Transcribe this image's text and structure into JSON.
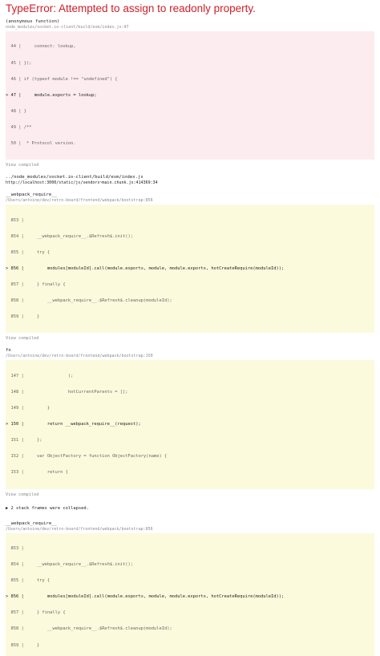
{
  "error_title": "TypeError: Attempted to assign to readonly property.",
  "frames": [
    {
      "name": "(anonymous function)",
      "path": "node_modules/socket.io-client/build/esm/index.js:47",
      "tint": "red",
      "lines": [
        "  44 |     connect: lookup,",
        "  45 | });",
        "  46 | if (typeof module !== \"undefined\") {",
        "> 47 |     module.exports = lookup;",
        "  48 | }",
        "  49 | /**",
        "  50 |  * Protocol version."
      ],
      "view_compiled": "View compiled"
    },
    {
      "name": "../node_modules/socket.io-client/build/esm/index.js",
      "path": "http://localhost:3000/static/js/vendors~main.chunk.js:414369:34",
      "path_dark": true
    },
    {
      "name": "__webpack_require__",
      "path": "/Users/antoine/dev/retro-board/frontend/webpack/bootstrap:856",
      "tint": "yellow",
      "lines": [
        "  853 |",
        "  854 |     __webpack_require__.$Refresh$.init();",
        "  855 |     try {",
        "> 856 |         modules[moduleId].call(module.exports, module, module.exports, hotCreateRequire(moduleId));",
        "  857 |     } finally {",
        "  858 |         __webpack_require__.$Refresh$.cleanup(moduleId);",
        "  859 |     }"
      ],
      "view_compiled": "View compiled"
    },
    {
      "name": "fn",
      "path": "/Users/antoine/dev/retro-board/frontend/webpack/bootstrap:150",
      "tint": "yellow",
      "lines": [
        "  147 |                 );",
        "  148 |                 hotCurrentParents = [];",
        "  149 |         }",
        "> 150 |         return __webpack_require__(request);",
        "  151 |     };",
        "  152 |     var ObjectFactory = function ObjectFactory(name) {",
        "  153 |         return {"
      ],
      "view_compiled": "View compiled"
    },
    {
      "name": "__webpack_require__",
      "path": "/Users/antoine/dev/retro-board/frontend/webpack/bootstrap:856",
      "tint": "yellow",
      "lines": [
        "  853 |",
        "  854 |     __webpack_require__.$Refresh$.init();",
        "  855 |     try {",
        "> 856 |         modules[moduleId].call(module.exports, module, module.exports, hotCreateRequire(moduleId));",
        "  857 |     } finally {",
        "  858 |         __webpack_require__.$Refresh$.cleanup(moduleId);",
        "  859 |     }"
      ]
    }
  ],
  "collapsed_text": "▶ 2 stack frames were collapsed.",
  "colors": {
    "error_red": "#d0202a",
    "red_tint": "#fdecef",
    "yellow_tint": "#fcfadd",
    "muted": "#8a8a8a"
  }
}
